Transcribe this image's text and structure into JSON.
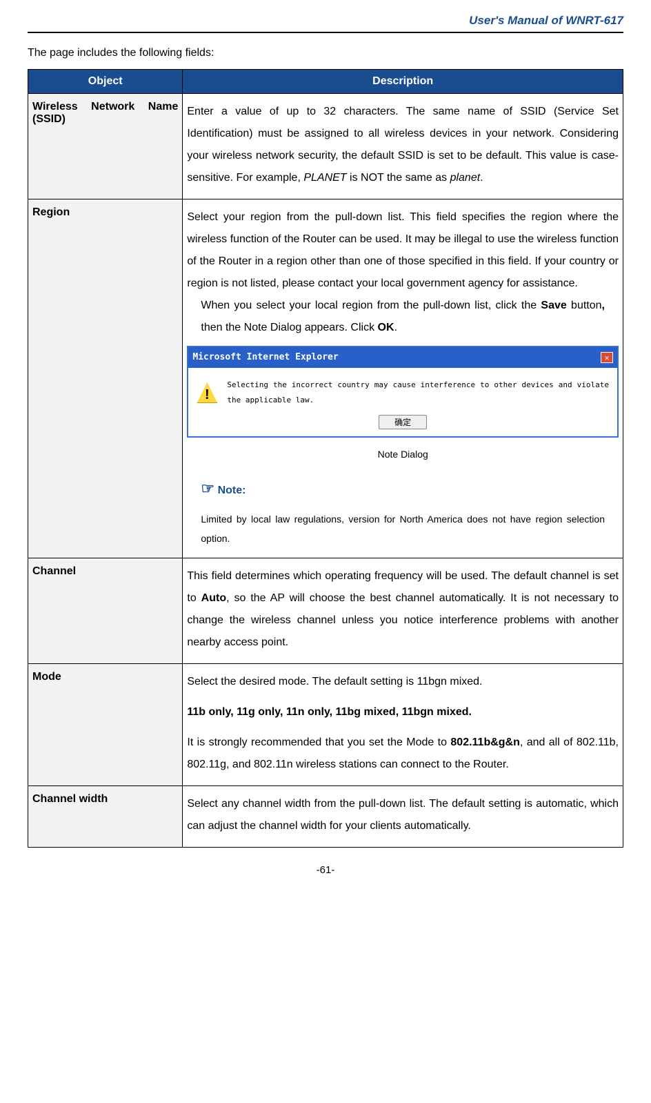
{
  "header": {
    "title": "User's Manual of WNRT-617"
  },
  "intro": "The page includes the following fields:",
  "table": {
    "head": {
      "object": "Object",
      "description": "Description"
    },
    "rows": [
      {
        "object": "Wireless Network Name (SSID)",
        "desc_pre": "Enter a value of up to 32 characters. The same name of SSID (Service Set Identification) must be assigned to all wireless devices in your network. Considering your wireless network security, the default SSID is set to be default. This value is case-sensitive. For example, ",
        "desc_em1": "PLANET",
        "desc_mid": " is NOT the same as ",
        "desc_em2": "planet",
        "desc_post": "."
      },
      {
        "object": "Region",
        "p1": "Select your region from the pull-down list. This field specifies the region where the wireless function of the Router can be used. It may be illegal to use the wireless function of the Router in a region other than one of those specified in this field. If your country or region is not listed, please contact your local government agency for assistance.",
        "p2_pre": "When you select your local region from the pull-down list, click the ",
        "p2_b1": "Save",
        "p2_mid1": " button",
        "p2_b2": ",",
        "p2_mid2": " then the Note Dialog appears. Click ",
        "p2_b3": "OK",
        "p2_post": ".",
        "dialog": {
          "title": "Microsoft Internet Explorer",
          "message": "Selecting the incorrect country may cause interference to other devices and violate the applicable law.",
          "ok": "确定"
        },
        "caption": "Note Dialog",
        "note_head": "Note:",
        "note_text": "Limited by local law regulations, version for North America does not have region selection option."
      },
      {
        "object": "Channel",
        "p_pre": "This field determines which operating frequency will be used. The default channel is set to ",
        "p_b1": "Auto",
        "p_post": ", so the AP will choose the best channel automatically. It is not necessary to change the wireless channel unless you notice interference problems with another nearby access point."
      },
      {
        "object": "Mode",
        "p1": "Select the desired mode. The default setting is 11bgn mixed.",
        "p2": "11b only, 11g only, 11n only, 11bg mixed, 11bgn mixed.",
        "p3_pre": "It is strongly recommended that you set the Mode to ",
        "p3_b": "802.11b&g&n",
        "p3_post": ", and all of 802.11b, 802.11g, and 802.11n wireless stations can connect to the Router."
      },
      {
        "object": "Channel width",
        "p1": "Select any channel width from the pull-down list. The default setting is automatic, which can adjust the channel width for your clients automatically."
      }
    ]
  },
  "footer": "-61-"
}
